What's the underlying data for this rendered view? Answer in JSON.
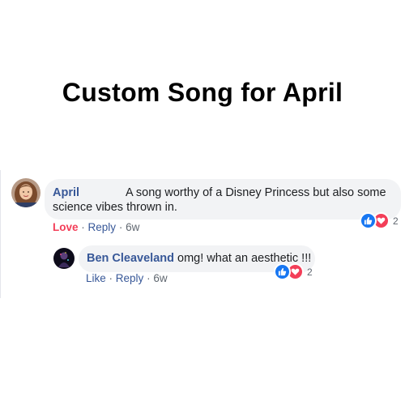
{
  "title": "Custom Song for April",
  "comments": [
    {
      "author": "April",
      "text_line1": "A song worthy of a Disney Princess but also some",
      "text_line2": "science vibes thrown in.",
      "reaction_label": "Love",
      "reply_label": "Reply",
      "time": "6w",
      "reaction_count": "2",
      "reaction_icons": [
        "like-icon",
        "love-icon"
      ]
    },
    {
      "author": "Ben Cleaveland",
      "text": "omg! what an aesthetic !!!",
      "like_label": "Like",
      "reply_label": "Reply",
      "time": "6w",
      "reaction_count": "2",
      "reaction_icons": [
        "like-icon",
        "love-icon"
      ]
    }
  ],
  "separator": "·",
  "colors": {
    "author": "#385898",
    "love": "#f33e58",
    "like": "#1877f2",
    "bubble": "#f2f3f5",
    "meta": "#606770"
  }
}
